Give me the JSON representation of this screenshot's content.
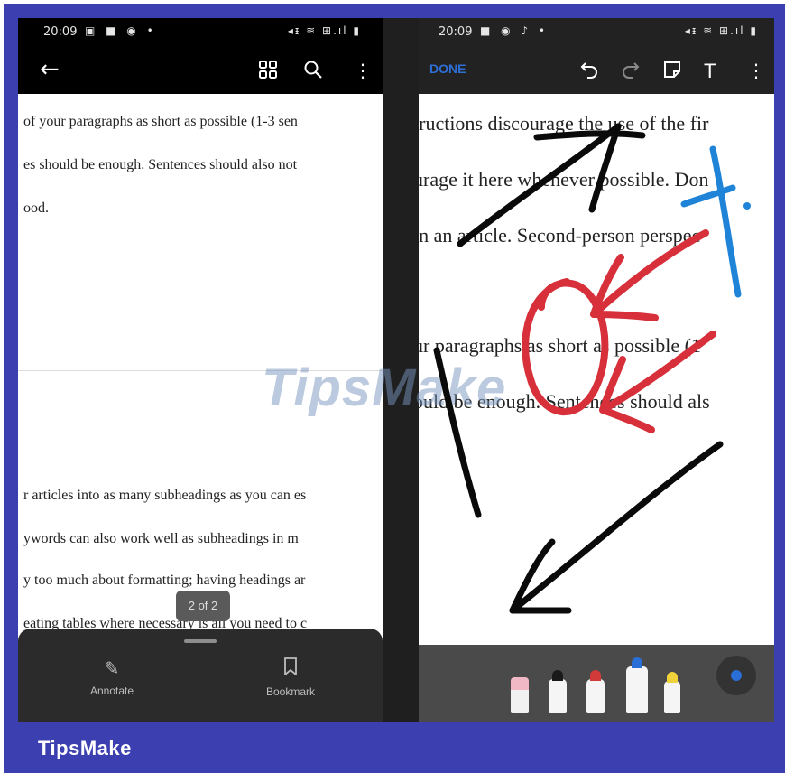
{
  "left_phone": {
    "status": {
      "time": "20:09",
      "icons": "▣ ■ ◉ •",
      "right_icons": "◂ᵻ ≋ ⊞.ıl ▮"
    },
    "appbar": {
      "back_icon": "arrow-left",
      "grid_icon": "grid",
      "search_icon": "search",
      "more_icon": "more-vertical"
    },
    "doc_lines": [
      "of your paragraphs as short as possible (1-3 sen",
      "es should be enough. Sentences should also not",
      "ood.",
      "r articles into as many subheadings as you can es",
      "ywords can also work well as subheadings in m",
      "y too much about formatting; having headings ar",
      "eating tables where necessary is all you need to c"
    ],
    "page_indicator": "2 of 2",
    "sheet": {
      "annotate_label": "Annotate",
      "bookmark_label": "Bookmark"
    }
  },
  "right_phone": {
    "status": {
      "time": "20:09",
      "icons": "■ ◉ ♪ •",
      "right_icons": "◂ᵻ ≋ ⊞.ıl ▮"
    },
    "appbar": {
      "done_label": "DONE",
      "undo_icon": "undo",
      "redo_icon": "redo",
      "sticky_note_icon": "sticky-note",
      "text_icon": "text-T",
      "more_icon": "more-vertical"
    },
    "doc_lines": [
      "tructions discourage the use of the fir",
      "urage it here whenever possible. Don",
      "in an article. Second-person perspec",
      "ur paragraphs as short as possible (1",
      "ould be enough. Sentences should als"
    ],
    "toolbar": {
      "tools": [
        {
          "name": "eraser",
          "color": "#f0b8c4"
        },
        {
          "name": "pen-black",
          "color": "#1a1a1a"
        },
        {
          "name": "pen-red",
          "color": "#d23a3a"
        },
        {
          "name": "pen-blue",
          "color": "#2a6ed8"
        },
        {
          "name": "highlighter-yellow",
          "color": "#f0d23a"
        }
      ],
      "selected_color": "#2a6ed8"
    }
  },
  "watermark": "TipsMake",
  "footer": {
    "brand": "TipsMake"
  },
  "colors": {
    "frame_blue": "#3b3fb0",
    "ink_black": "#0a0a0a",
    "ink_red": "#d7303a",
    "ink_blue": "#1f84d8"
  }
}
